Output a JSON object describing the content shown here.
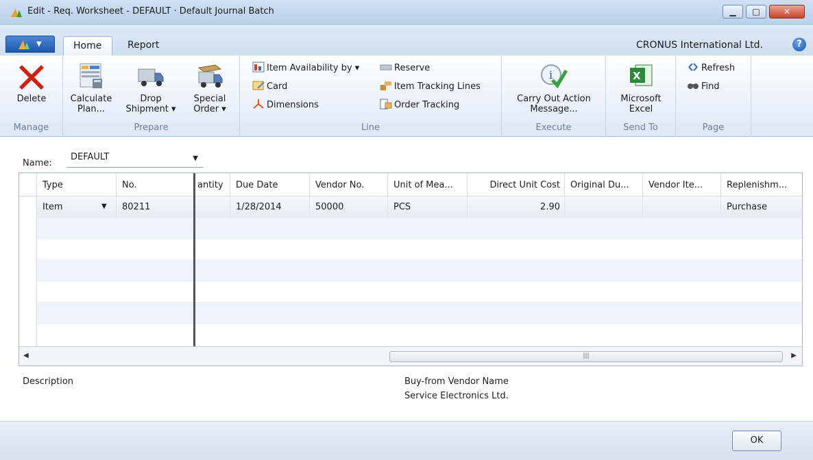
{
  "window": {
    "title": "Edit - Req. Worksheet - DEFAULT · Default Journal Batch"
  },
  "ribbon": {
    "tabs": [
      {
        "label": "Home"
      },
      {
        "label": "Report"
      }
    ],
    "company": "CRONUS International Ltd.",
    "groups": {
      "manage": {
        "label": "Manage",
        "delete": "Delete"
      },
      "prepare": {
        "label": "Prepare",
        "calculate_1": "Calculate",
        "calculate_2": "Plan...",
        "drop_1": "Drop",
        "drop_2": "Shipment ▾",
        "special_1": "Special",
        "special_2": "Order ▾"
      },
      "line": {
        "label": "Line",
        "item_availability": "Item Availability by ▾",
        "reserve": "Reserve",
        "card": "Card",
        "item_tracking": "Item Tracking Lines",
        "dimensions": "Dimensions",
        "order_tracking": "Order Tracking"
      },
      "execute": {
        "label": "Execute",
        "carry_1": "Carry Out Action",
        "carry_2": "Message..."
      },
      "send_to": {
        "label": "Send To",
        "excel_1": "Microsoft",
        "excel_2": "Excel"
      },
      "page": {
        "label": "Page",
        "refresh": "Refresh",
        "find": "Find"
      }
    }
  },
  "filter": {
    "name_label": "Name:",
    "name_value": "DEFAULT"
  },
  "grid": {
    "columns": [
      "Type",
      "No.",
      "antity",
      "Due Date",
      "Vendor No.",
      "Unit of Mea...",
      "Direct Unit Cost",
      "Original Du...",
      "Vendor Ite...",
      "Replenishm..."
    ],
    "rows": [
      {
        "type": "Item",
        "no": "80211",
        "quantity": "",
        "due_date": "1/28/2014",
        "vendor_no": "50000",
        "uom": "PCS",
        "direct_unit_cost": "2.90",
        "original_due": "",
        "vendor_item": "",
        "replenishment": "Purchase"
      }
    ]
  },
  "factbox": {
    "description_label": "Description",
    "vendor_name_label": "Buy-from Vendor Name",
    "vendor_name_value": "Service Electronics Ltd."
  },
  "footer": {
    "ok_label": "OK"
  }
}
